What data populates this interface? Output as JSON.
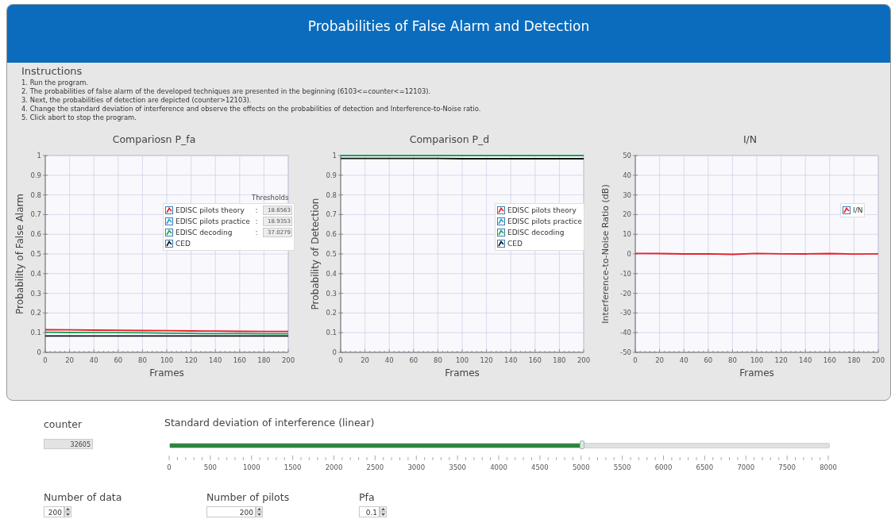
{
  "window": {
    "title": "Probabilities of False Alarm and Detection"
  },
  "instructions": {
    "heading": "Instructions",
    "steps": [
      "1. Run the program.",
      "2. The probabilities of false alarm of the developed techniques are presented in the beginning (6103<=counter<=12103).",
      "3. Next, the probabilities of detection are depicted (counter>12103).",
      "4. Change the standard deviation of interference and observe the effects on the probabilities of detection and Interference-to-Noise ratio.",
      "5. Click abort to stop the program."
    ]
  },
  "charts": [
    {
      "chart_data": {
        "type": "line",
        "grid": true,
        "title": "Compariosn P_fa",
        "xlabel": "Frames",
        "ylabel": "Probability of False Alarm",
        "x": [
          0,
          20,
          40,
          60,
          80,
          100,
          120,
          140,
          160,
          180,
          200
        ],
        "xlim": [
          0,
          200
        ],
        "ylim": [
          0,
          1
        ],
        "xticks": [
          0,
          20,
          40,
          60,
          80,
          100,
          120,
          140,
          160,
          180,
          200
        ],
        "yticks": [
          0,
          0.1,
          0.2,
          0.3,
          0.4,
          0.5,
          0.6,
          0.7,
          0.8,
          0.9,
          1
        ],
        "series": [
          {
            "name": "EDISC pilots theory",
            "color": "#e8212b",
            "values": [
              0.115,
              0.114,
              0.113,
              0.112,
              0.111,
              0.11,
              0.109,
              0.108,
              0.107,
              0.106,
              0.106
            ]
          },
          {
            "name": "EDISC pilots practice",
            "color": "#1e9fd8",
            "values": [
              null,
              null,
              null,
              null,
              null,
              null,
              null,
              null,
              null,
              null,
              null
            ]
          },
          {
            "name": "EDISC decoding",
            "color": "#1aa35a",
            "values": [
              0.102,
              0.101,
              0.1,
              0.1,
              0.099,
              0.097,
              0.096,
              0.095,
              0.095,
              0.094,
              0.094
            ]
          },
          {
            "name": "CED",
            "color": "#111111",
            "values": [
              0.083,
              0.083,
              0.083,
              0.083,
              0.083,
              0.083,
              0.083,
              0.083,
              0.083,
              0.083,
              0.083
            ]
          }
        ]
      },
      "thresholds": {
        "label": "Thresholds",
        "rows": [
          {
            "separator": ":",
            "value": "18.6563"
          },
          {
            "separator": ":",
            "value": "18.9353"
          },
          {
            "separator": ":",
            "value": "37.0279"
          }
        ]
      }
    },
    {
      "chart_data": {
        "type": "line",
        "grid": true,
        "title": "Comparison P_d",
        "xlabel": "Frames",
        "ylabel": "Probability of Detection",
        "x": [
          0,
          20,
          40,
          60,
          80,
          100,
          120,
          140,
          160,
          180,
          200
        ],
        "xlim": [
          0,
          200
        ],
        "ylim": [
          0,
          1
        ],
        "xticks": [
          0,
          20,
          40,
          60,
          80,
          100,
          120,
          140,
          160,
          180,
          200
        ],
        "yticks": [
          0,
          0.1,
          0.2,
          0.3,
          0.4,
          0.5,
          0.6,
          0.7,
          0.8,
          0.9,
          1
        ],
        "series": [
          {
            "name": "EDISC pilots theory",
            "color": "#e8212b",
            "values": [
              null,
              null,
              null,
              null,
              null,
              null,
              null,
              null,
              null,
              null,
              null
            ]
          },
          {
            "name": "EDISC pilots practice",
            "color": "#1e9fd8",
            "values": [
              null,
              null,
              null,
              null,
              null,
              null,
              null,
              null,
              null,
              null,
              null
            ]
          },
          {
            "name": "EDISC decoding",
            "color": "#1aa35a",
            "values": [
              1,
              1,
              1,
              1,
              1,
              1,
              1,
              1,
              1,
              1,
              1
            ]
          },
          {
            "name": "CED",
            "color": "#111111",
            "values": [
              0.985,
              0.985,
              0.985,
              0.985,
              0.985,
              0.984,
              0.984,
              0.984,
              0.984,
              0.984,
              0.984
            ]
          }
        ]
      }
    },
    {
      "chart_data": {
        "type": "line",
        "grid": true,
        "title": "I/N",
        "xlabel": "Frames",
        "ylabel": "Interference-to-Noise Ratio (dB)",
        "x": [
          0,
          20,
          40,
          60,
          80,
          100,
          120,
          140,
          160,
          180,
          200
        ],
        "xlim": [
          0,
          200
        ],
        "ylim": [
          -50,
          50
        ],
        "xticks": [
          0,
          20,
          40,
          60,
          80,
          100,
          120,
          140,
          160,
          180,
          200
        ],
        "yticks": [
          -50,
          -40,
          -30,
          -20,
          -10,
          0,
          10,
          20,
          30,
          40,
          50
        ],
        "series": [
          {
            "name": "I/N",
            "color": "#e8212b",
            "values": [
              0.3,
              0.2,
              0,
              0.1,
              -0.2,
              0.3,
              0.1,
              0,
              0.2,
              -0.1,
              0.1
            ]
          }
        ]
      }
    }
  ],
  "counter": {
    "label": "counter",
    "value": "32605"
  },
  "slider": {
    "label": "Standard deviation of interference (linear)",
    "level": 0.625,
    "scale": [
      "0",
      "500",
      "1000",
      "1500",
      "2000",
      "2500",
      "3000",
      "3500",
      "4000",
      "4500",
      "5000",
      "5500",
      "6000",
      "6500",
      "7000",
      "7500",
      "8000"
    ]
  },
  "numeric_inputs": [
    {
      "label": "Number of data",
      "value": "200"
    },
    {
      "label": "Number of pilots",
      "value": "200"
    },
    {
      "label": "Pfa",
      "value": "0.1"
    }
  ]
}
